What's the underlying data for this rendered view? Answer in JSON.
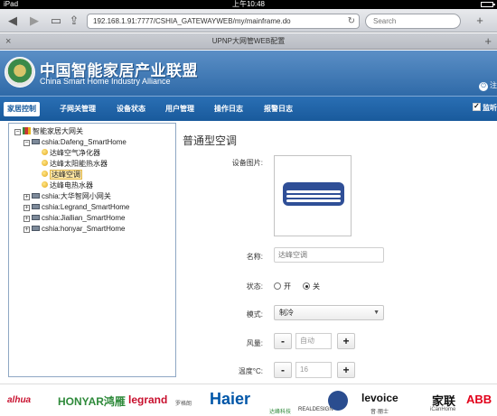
{
  "status_bar": {
    "carrier": "iPad",
    "time": "上午10:48"
  },
  "browser": {
    "url": "192.168.1.91:7777/CSHIA_GATEWAYWEB/my/mainframe.do",
    "search_placeholder": "Search",
    "tab_title": "UPNP大网管WEB配置"
  },
  "site": {
    "title_cn": "中国智能家居产业联盟",
    "title_en": "China Smart Home Industry Alliance",
    "logout_label": "注"
  },
  "nav": {
    "items": [
      "家居控制",
      "子网关管理",
      "设备状态",
      "用户管理",
      "操作日志",
      "报警日志"
    ],
    "active_index": 0,
    "monitor_label": "监听"
  },
  "tree": {
    "root": "智能家居大网关",
    "gateways": [
      {
        "label": "cshia:Dafeng_SmartHome",
        "expanded": true,
        "children": [
          "达峰空气净化器",
          "达峰太阳能热水器",
          "达峰空调",
          "达峰电热水器"
        ]
      },
      {
        "label": "cshia:大华智网小网关",
        "expanded": false
      },
      {
        "label": "cshia:Legrand_SmartHome",
        "expanded": false
      },
      {
        "label": "cshia:Jiallian_SmartHome",
        "expanded": false
      },
      {
        "label": "cshia:honyar_SmartHome",
        "expanded": false
      }
    ],
    "selected": "达峰空调"
  },
  "device": {
    "panel_title": "普通型空调",
    "image_label": "设备图片:",
    "name_label": "名称:",
    "name_placeholder": "达峰空调",
    "status_label": "状态:",
    "status_on": "开",
    "status_off": "关",
    "status_value": "关",
    "mode_label": "模式:",
    "mode_value": "制冷",
    "fan_label": "风量:",
    "fan_value": "自动",
    "temp_label": "温度°C:",
    "temp_value": "16",
    "minus": "-",
    "plus": "+"
  },
  "partners": {
    "dahua": "alhua",
    "honyar": "HONYAR鸿雁",
    "legrand": "legrand",
    "legrand_cn": "罗格朗",
    "haier": "Haier",
    "dafeng": "达峰科技",
    "realdesign": "REALDESIGN",
    "levoice": "levoice",
    "levoice_cn": "音·丽士",
    "jialian": "家联",
    "jialian_en": "iCanHome",
    "abb": "ABB"
  },
  "colors": {
    "header_blue": "#2f6aa8",
    "nav_blue": "#195a9c",
    "honyar_green": "#2f8a3b",
    "legrand_red": "#c8102e",
    "haier_blue": "#0056a8",
    "abb_red": "#e2001a"
  }
}
